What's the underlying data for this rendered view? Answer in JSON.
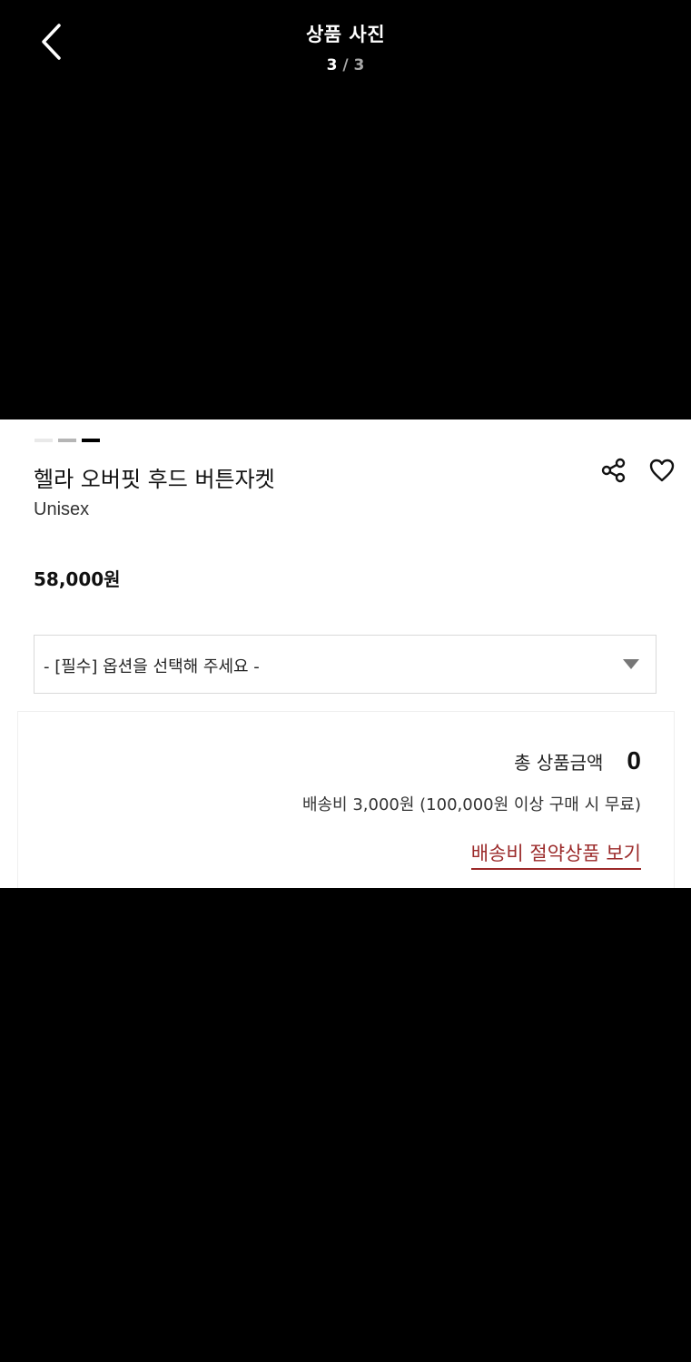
{
  "header": {
    "title": "상품 사진",
    "counter": {
      "current": "3",
      "separator": "/",
      "total": "3"
    },
    "back_icon": "chevron-left-icon"
  },
  "gallery": {
    "slides_total": 3,
    "active_slide": 3
  },
  "product": {
    "name": "헬라 오버핏 후드 버튼자켓",
    "subtitle": "Unisex",
    "price": "58,000원",
    "share_icon": "share-icon",
    "like_icon": "heart-icon"
  },
  "option": {
    "placeholder": "- [필수] 옵션을 선택해 주세요 -"
  },
  "summary": {
    "total_label": "총 상품금액",
    "total_value": "0",
    "shipping_note": "배송비 3,000원 (100,000원 이상 구매 시 무료)",
    "saving_link": "배송비 절약상품 보기"
  },
  "colors": {
    "background": "#000000",
    "panel": "#ffffff",
    "link": "#9b2a2a"
  }
}
